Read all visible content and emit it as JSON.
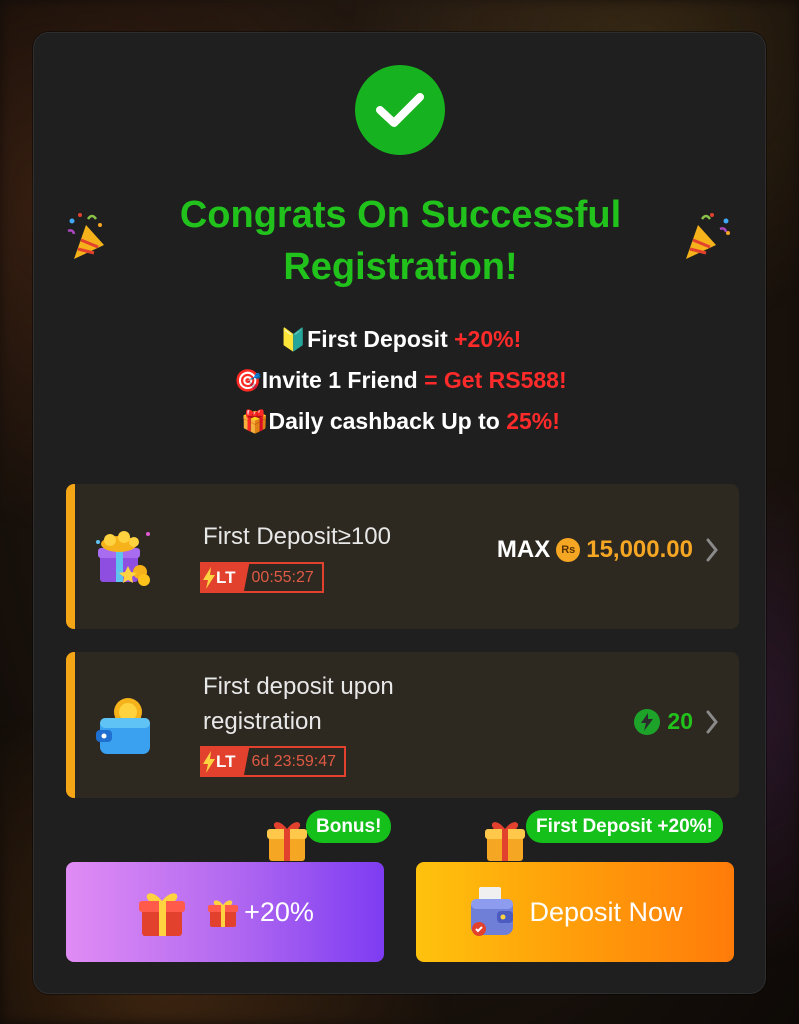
{
  "modal": {
    "title": "Congrats On Successful Registration!",
    "perks": [
      {
        "emoji": "🔰",
        "text": "First Deposit",
        "highlight": "+20%!"
      },
      {
        "emoji": "🎯",
        "text": "Invite 1 Friend",
        "highlight": "= Get RS588!"
      },
      {
        "emoji": "🎁",
        "text": "Daily cashback Up to",
        "highlight": "25%!"
      }
    ]
  },
  "cards": [
    {
      "title": "First Deposit≥100",
      "lt_label": "LT",
      "timer": "00:55:27",
      "max_label": "MAX",
      "currency_symbol": "Rs",
      "value": "15,000.00"
    },
    {
      "title": "First deposit upon registration",
      "lt_label": "LT",
      "timer": "6d 23:59:47",
      "value": "20"
    }
  ],
  "buttons": {
    "bonus_label": "+20%",
    "bonus_ribbon": "Bonus!",
    "deposit_label": "Deposit Now",
    "deposit_ribbon": "First Deposit +20%!"
  },
  "colors": {
    "success_green": "#22c21c",
    "highlight_red": "#ff2a2a",
    "accent_orange": "#f5a623",
    "card_bg": "#2d2820",
    "modal_bg": "#1f1f1f"
  }
}
